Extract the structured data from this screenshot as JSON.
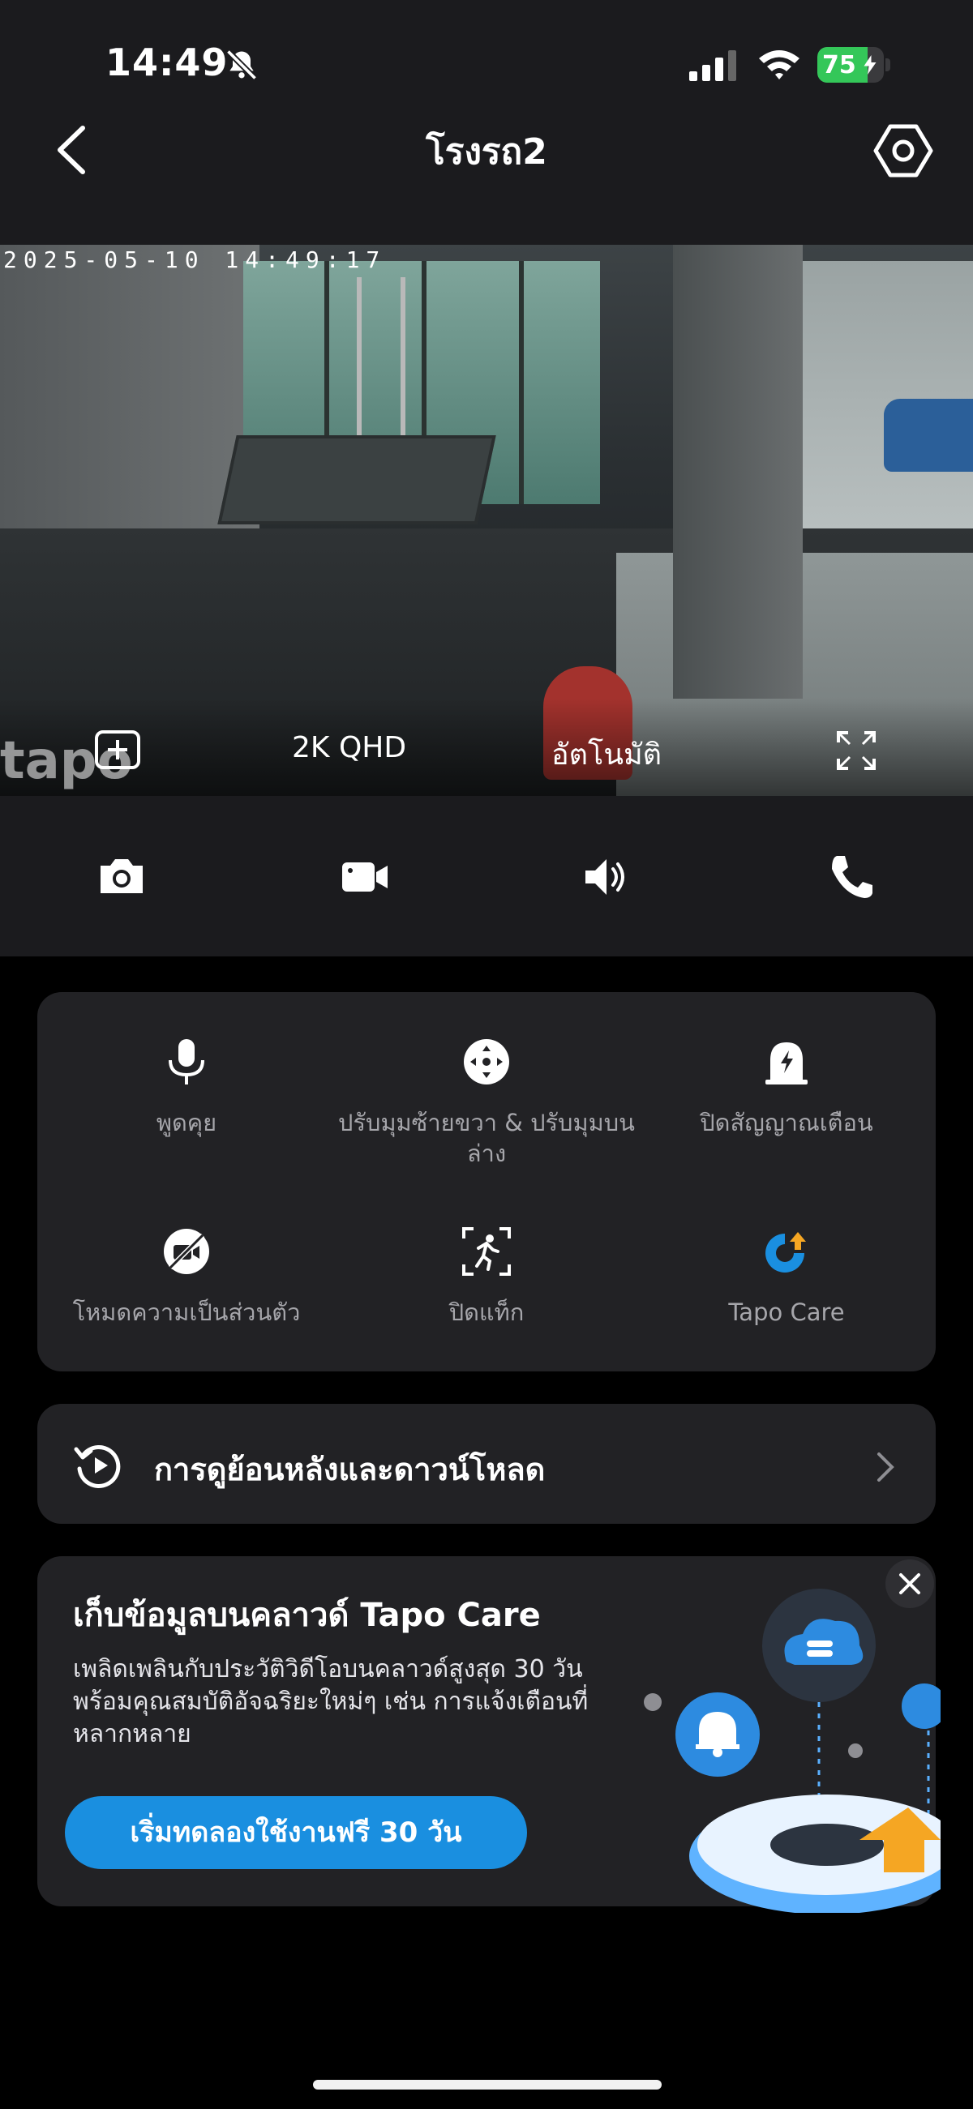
{
  "status_bar": {
    "time": "14:49",
    "battery_percent": 75,
    "battery_label": "75",
    "colors": {
      "battery": "#34c759"
    },
    "icons": [
      "bell-slash-icon",
      "cellular-signal-icon",
      "wifi-icon",
      "battery-charging-icon"
    ]
  },
  "header": {
    "title": "โรงรถ2",
    "icons": [
      "chevron-left-icon",
      "settings-gear-icon"
    ]
  },
  "video": {
    "timestamp": "2025-05-10 14:49:17",
    "watermark": "tapo",
    "quality_label": "2K QHD",
    "mode_label": "อัตโนมัติ",
    "icons": [
      "add-square-icon",
      "fullscreen-icon"
    ]
  },
  "controls": {
    "icons": [
      "camera-icon",
      "video-record-icon",
      "speaker-icon",
      "phone-icon"
    ]
  },
  "features": [
    {
      "label": "พูดคุย",
      "icon": "microphone-icon"
    },
    {
      "label": "ปรับมุมซ้ายขวา & ปรับมุมบนล่าง",
      "icon": "pan-tilt-icon"
    },
    {
      "label": "ปิดสัญญาณเตือน",
      "icon": "alarm-siren-icon"
    },
    {
      "label": "โหมดความเป็นส่วนตัว",
      "icon": "privacy-mode-icon"
    },
    {
      "label": "ปิดแท็ก",
      "icon": "motion-tag-icon"
    },
    {
      "label": "Tapo Care",
      "icon": "tapo-care-icon"
    }
  ],
  "replay": {
    "label": "การดูย้อนหลังและดาวน์โหลด",
    "icons": [
      "playback-icon",
      "chevron-right-icon"
    ]
  },
  "promo": {
    "title": "เก็บข้อมูลบนคลาวด์ Tapo Care",
    "description": "เพลิดเพลินกับประวัติวิดีโอบนคลาวด์สูงสุด 30 วัน พร้อมคุณสมบัติอัจฉริยะใหม่ๆ เช่น การแจ้งเตือนที่หลากหลาย",
    "button_label": "เริ่มทดลองใช้งานฟรี 30 วัน",
    "colors": {
      "button": "#1a8fe0"
    },
    "icons": [
      "close-icon",
      "cloud-storage-illustration"
    ]
  }
}
